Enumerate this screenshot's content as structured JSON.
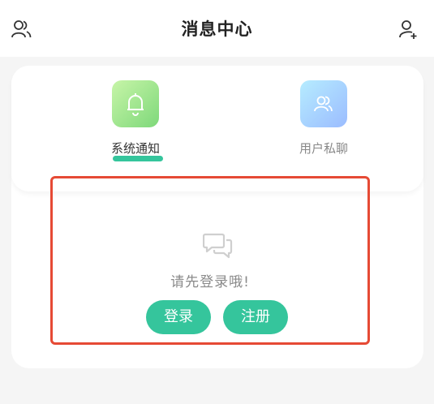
{
  "header": {
    "title": "消息中心",
    "left_icon": "users-icon",
    "right_icon": "add-user-icon"
  },
  "tabs": [
    {
      "label": "系统通知",
      "icon": "bell-icon",
      "active": true
    },
    {
      "label": "用户私聊",
      "icon": "users-icon",
      "active": false
    }
  ],
  "empty_state": {
    "icon": "chat-bubbles-icon",
    "message": "请先登录哦!",
    "login_label": "登录",
    "register_label": "注册"
  },
  "colors": {
    "accent": "#35c59c",
    "highlight_border": "#e64a35",
    "notice_tile": "#9fe68d",
    "chat_tile": "#a9c9ff"
  }
}
